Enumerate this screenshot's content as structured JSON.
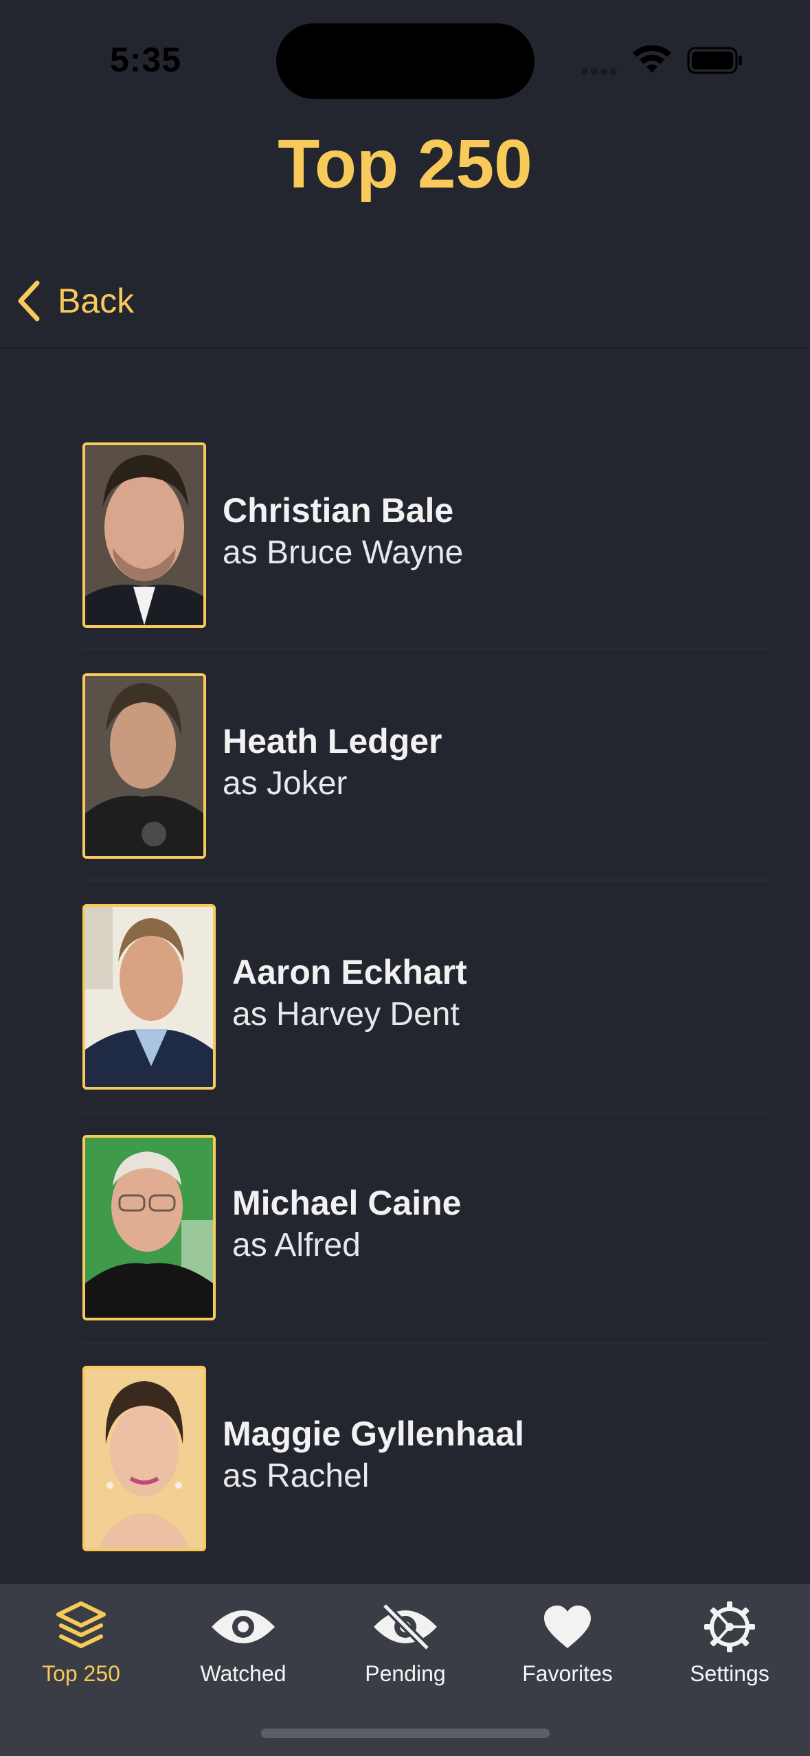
{
  "status_bar": {
    "time": "5:35"
  },
  "nav": {
    "title": "Top 250",
    "back_label": "Back"
  },
  "theme": {
    "accent": "#f8ca5a",
    "background": "#23262f",
    "tab_bar_background": "#3a3d45"
  },
  "cast": [
    {
      "name": "Christian Bale",
      "character": "as Bruce Wayne"
    },
    {
      "name": "Heath Ledger",
      "character": "as Joker"
    },
    {
      "name": "Aaron Eckhart",
      "character": "as Harvey Dent"
    },
    {
      "name": "Michael Caine",
      "character": "as Alfred"
    },
    {
      "name": "Maggie Gyllenhaal",
      "character": "as Rachel"
    }
  ],
  "tabs": [
    {
      "label": "Top 250",
      "icon": "layers-icon",
      "active": true
    },
    {
      "label": "Watched",
      "icon": "eye-icon",
      "active": false
    },
    {
      "label": "Pending",
      "icon": "eye-slash-icon",
      "active": false
    },
    {
      "label": "Favorites",
      "icon": "heart-icon",
      "active": false
    },
    {
      "label": "Settings",
      "icon": "gear-icon",
      "active": false
    }
  ]
}
